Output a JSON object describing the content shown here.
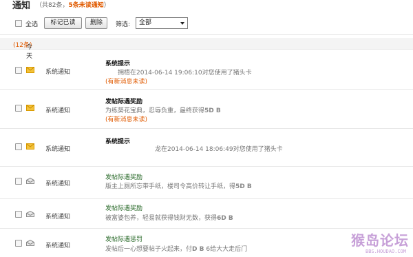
{
  "header": {
    "title": "通知",
    "count_prefix": "（共82条，",
    "unread_text": "5条未读通知",
    "count_suffix": "）"
  },
  "toolbar": {
    "select_all_label": "全选",
    "mark_read_label": "标记已读",
    "delete_label": "删除",
    "filter_label": "筛选:",
    "filter_value": "全部"
  },
  "group": {
    "label": "今天",
    "count": "(12条)"
  },
  "messages": [
    {
      "category": "系统通知",
      "title": "系统提示",
      "body": "　　拥梧在2014-06-14 19:06:10对您使用了猪头卡",
      "new_flag": "(有新消息未读)"
    },
    {
      "category": "系统通知",
      "title": "发帖际遇奖励",
      "body_pre": "为练葵花宝典，忍辱负重，最终获得",
      "body_bold": "5D B",
      "new_flag": "(有新消息未读)"
    },
    {
      "category": "系统通知",
      "title": "系统提示",
      "body": "　　　　　　　　龙在2014-06-14 18:06:49对您使用了猪头卡"
    },
    {
      "category": "系统通知",
      "title": "发帖际遇奖励",
      "body_pre": "版主上厕所忘带手纸，楼司令高价转让手纸，得",
      "body_bold": "5D B"
    },
    {
      "category": "系统通知",
      "title": "发帖际遇奖励",
      "body_pre": "被富婆包养，轻易就获得钱财无数，获得",
      "body_bold": "6D B"
    },
    {
      "category": "系统通知",
      "title": "发帖际遇惩罚",
      "body_pre": "发帖后一心想要帖子火起来，付",
      "body_bold": "D B",
      "body_post": " 6给大大走后门"
    }
  ],
  "watermark": {
    "main": "猴岛论坛",
    "sub": "BBS.HOUDAO.COM"
  },
  "colors": {
    "accent": "#e05a00",
    "envelope_unread": "#f0b400",
    "envelope_read": "#9a9a9a"
  }
}
